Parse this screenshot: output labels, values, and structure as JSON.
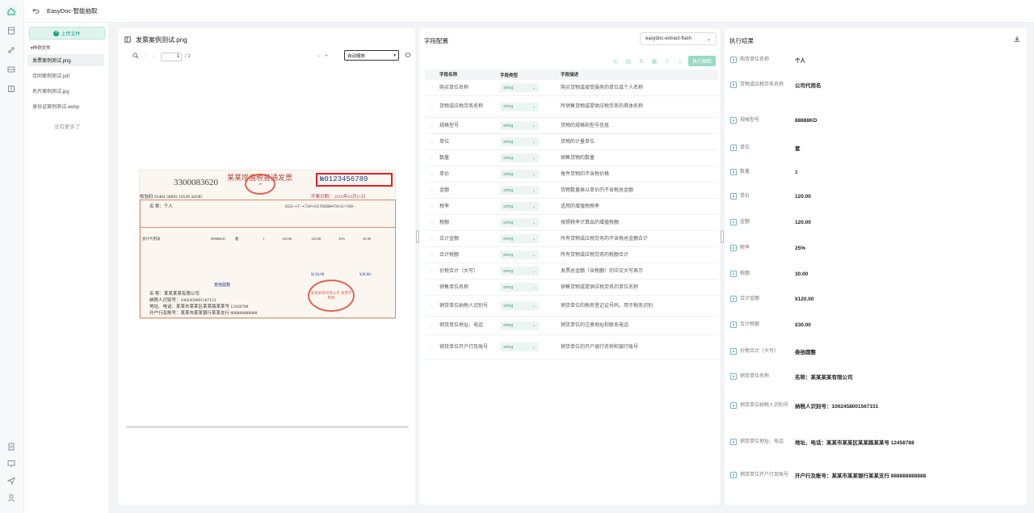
{
  "app": {
    "title": "EasyDoc-智能抽取"
  },
  "sidebar": {
    "upload_label": "上传文件",
    "group_label": "▾样例文件",
    "files": [
      "发票案例测试.png",
      "合同案例测试.pdf",
      "名片案例测试.jpg",
      "身份证案例测试.webp"
    ],
    "no_more": "没有更多了"
  },
  "viewer": {
    "title": "发票案例测试.png",
    "page_current": "1",
    "page_total": "/ 1",
    "zoom_label": "自动缩放",
    "zoom_minus": "−",
    "zoom_plus": "+"
  },
  "invoice": {
    "code": "3300083620",
    "title": "某某增值税普通发票",
    "number": "№0123456789",
    "invoice_no": "校验码 93484 36892 10549 44590",
    "date": "开票日期： 2016年03月15日",
    "buyer_name": "名 称：个人",
    "cipher": "033-+7-+73#>2176608470>2/<69-",
    "line_item": "会计代用表",
    "spec": "88888KD",
    "unit": "套",
    "qty": "1",
    "price": "120.00",
    "amount": "120.00",
    "rate": "25%",
    "tax": "30.00",
    "total_amount": "¥120.00",
    "total_tax": "¥30.00",
    "words": "叁拾圆整",
    "seller_name": "名 称：某某某某有限公司",
    "seller_taxid": "纳税人识别号：1002458001567151",
    "seller_addr": "地址、电话：某某市某某区某某路某某号 12458788",
    "seller_bank": "开户行及账号：某某市某某银行某某支行 888888888888",
    "stamp_text": "某某某某有限公司 发票专用章"
  },
  "config": {
    "title": "字段配置",
    "model": "easydoc-extract-flash",
    "run_label": "执行抽取",
    "headers": [
      "字段名称",
      "字段类型",
      "字段描述"
    ],
    "rows": [
      {
        "name": "购买单位名称",
        "type": "string",
        "desc": "购买货物或接受服务的单位或个人名称"
      },
      {
        "name": "货物或应税劳务名称",
        "type": "string",
        "desc": "所销售货物或提供应税劳务的具体名称"
      },
      {
        "name": "规格型号",
        "type": "string",
        "desc": "货物的规格和型号信息"
      },
      {
        "name": "单位",
        "type": "string",
        "desc": "货物的计量单位"
      },
      {
        "name": "数量",
        "type": "string",
        "desc": "销售货物的数量"
      },
      {
        "name": "单价",
        "type": "string",
        "desc": "每件货物的不含税价格"
      },
      {
        "name": "金额",
        "type": "string",
        "desc": "货物数量乘以单价的不含税总金额"
      },
      {
        "name": "税率",
        "type": "string",
        "desc": "适用的增值税税率"
      },
      {
        "name": "税额",
        "type": "string",
        "desc": "按照税率计算出的增值税额"
      },
      {
        "name": "合计金额",
        "type": "string",
        "desc": "所有货物或应税劳务的不含税总金额合计"
      },
      {
        "name": "合计税额",
        "type": "string",
        "desc": "所有货物或应税劳务的税额合计"
      },
      {
        "name": "价税合计（大写）",
        "type": "string",
        "desc": "发票总金额（含税额）的中文大写表示"
      },
      {
        "name": "销售单位名称",
        "type": "string",
        "desc": "销售货物或提供应税劳务的单位名称"
      },
      {
        "name": "销货单位纳税人识别号",
        "type": "string",
        "desc": "销货单位的税务登记证号码，用于税务识别"
      },
      {
        "name": "销货单位地址、电话",
        "type": "string",
        "desc": "销货单位的注册地址和联系电话"
      },
      {
        "name": "销货单位开户行及账号",
        "type": "string",
        "desc": "销货单位的开户银行名称和银行账号"
      }
    ]
  },
  "results": {
    "title": "执行结果",
    "items": [
      {
        "key": "购货单位名称",
        "value": "个人"
      },
      {
        "key": "货物或应税劳务名称",
        "value": "公司代用名"
      },
      {
        "key": "规格型号",
        "value": "88888KD"
      },
      {
        "key": "单位",
        "value": "套"
      },
      {
        "key": "数量",
        "value": "1"
      },
      {
        "key": "单价",
        "value": "120.00"
      },
      {
        "key": "金额",
        "value": "120.00"
      },
      {
        "key": "税率",
        "value": "25%"
      },
      {
        "key": "税额",
        "value": "30.00"
      },
      {
        "key": "合计金额",
        "value": "¥120.00"
      },
      {
        "key": "合计税额",
        "value": "¥30.00"
      },
      {
        "key": "价税合计（大写）",
        "value": "叁拾圆整"
      },
      {
        "key": "销货单位名称",
        "value": "名称：某某某某有限公司"
      },
      {
        "key": "销货单位纳税人识别号",
        "value": "纳税人识别号：1002458001567151"
      },
      {
        "key": "销货单位地址、电话",
        "value": "地址、电话：某某市某某区某某路某某号 12458788"
      },
      {
        "key": "销货单位开户行及账号",
        "value": "开户行及账号：某某市某某银行某某支行 888888888888"
      }
    ]
  }
}
